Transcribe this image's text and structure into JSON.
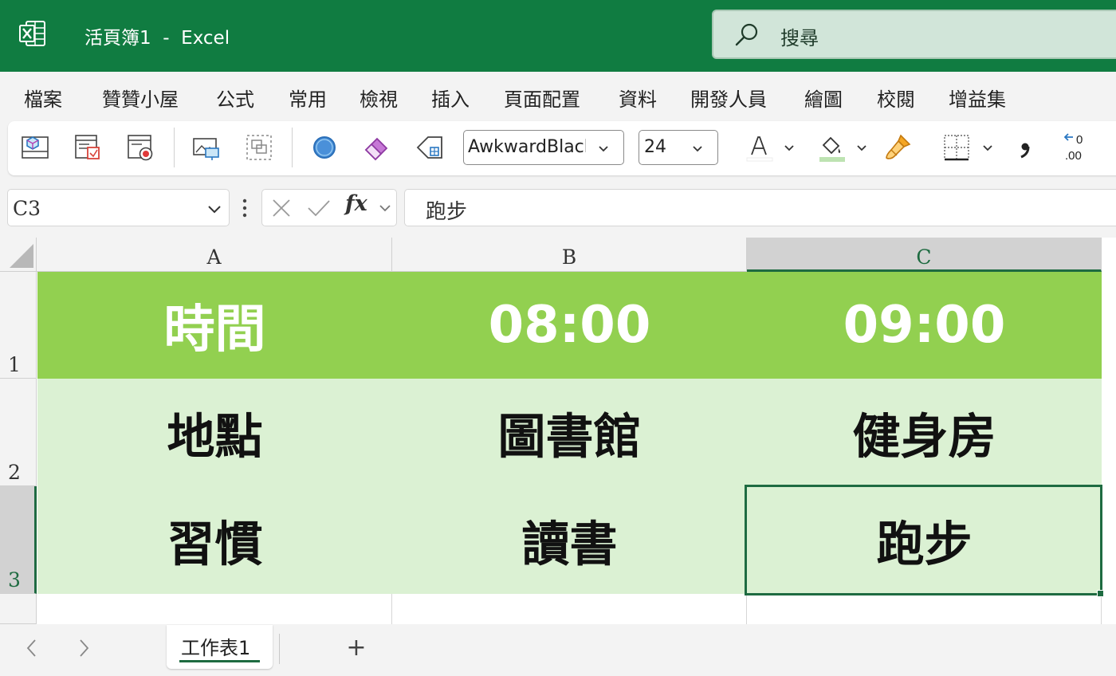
{
  "titlebar": {
    "title": "活頁簿1  -  Excel",
    "search_placeholder": "搜尋",
    "accent_color": "#107c41"
  },
  "menu": {
    "items": [
      "檔案",
      "贊贊小屋",
      "公式",
      "常用",
      "檢視",
      "插入",
      "頁面配置",
      "資料",
      "開發人員",
      "繪圖",
      "校閱",
      "增益集"
    ]
  },
  "ribbon": {
    "font_name": "AwkwardBlack",
    "font_size": "24",
    "icons": [
      "3d-box-icon",
      "page-layout-icon",
      "record-macro-icon",
      "picture-icon",
      "group-objects-icon",
      "circle-shape-icon",
      "eraser-icon",
      "tag-icon",
      "font-color-icon",
      "fill-color-icon",
      "format-painter-icon",
      "borders-icon",
      "comma-style-icon",
      "decrease-decimal-icon"
    ],
    "decrease_decimal_text": ".00"
  },
  "formula_bar": {
    "name_box": "C3",
    "formula": "跑步",
    "fx_label": "fx"
  },
  "grid": {
    "columns": [
      "A",
      "B",
      "C"
    ],
    "rows": [
      "1",
      "2",
      "3"
    ],
    "selected_cell": "C3",
    "cells": [
      [
        "時間",
        "08:00",
        "09:00"
      ],
      [
        "地點",
        "圖書館",
        "健身房"
      ],
      [
        "習慣",
        "讀書",
        "跑步"
      ]
    ],
    "header_fill": "#92d050",
    "body_fill": "#dbf1d3"
  },
  "sheets": {
    "tabs": [
      "工作表1"
    ],
    "add_label": "+"
  }
}
